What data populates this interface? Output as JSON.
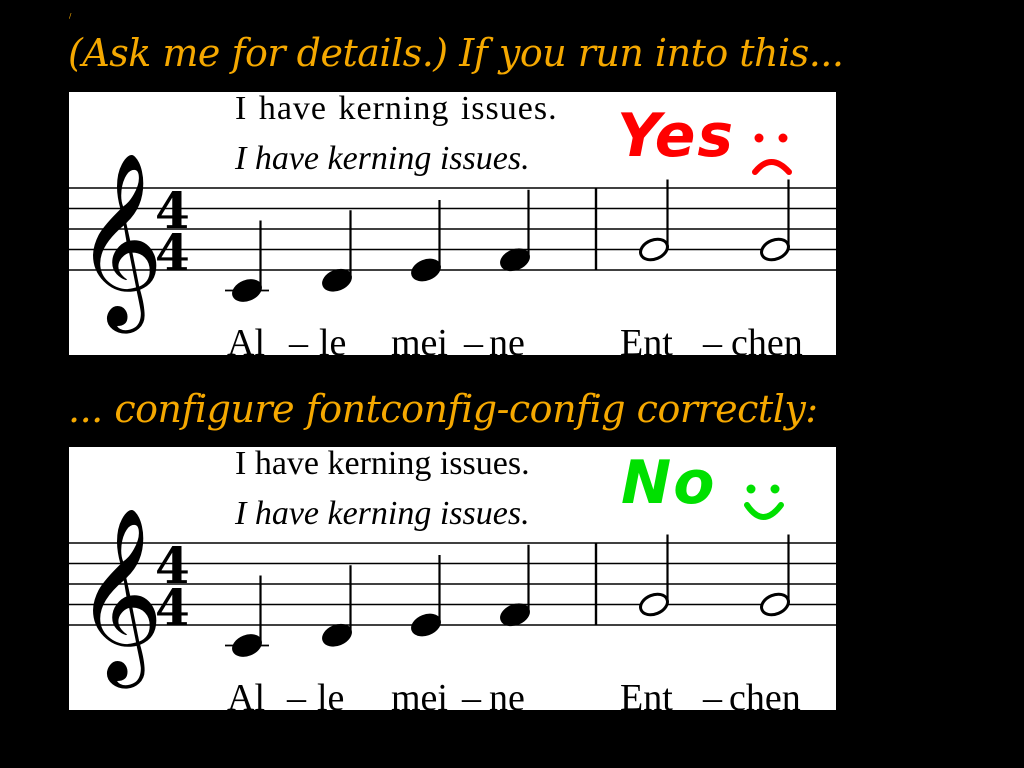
{
  "slide": {
    "corner_mark": "/",
    "heading_1": "(Ask me for details.) If you run into this...",
    "heading_2": "... configure fontconfig-config correctly:"
  },
  "sample_text": {
    "upright": "I have kerning issues.",
    "italic": "I have kerning issues."
  },
  "lyrics": {
    "al": "Al",
    "le": "le",
    "mei": "mei",
    "ne": "ne",
    "ent": "Ent",
    "chen": "chen",
    "hyphen": "–"
  },
  "annotations": {
    "yes": "Yes",
    "no": "No",
    "sad_face": "sad-face-icon",
    "happy_face": "happy-face-icon"
  },
  "colors": {
    "heading": "#f5a800",
    "yes": "#ff0000",
    "no": "#00e000",
    "background": "#000000",
    "panel": "#ffffff"
  },
  "music": {
    "clef": "treble",
    "time_signature": "4/4",
    "notes_measure_1": [
      "C",
      "D",
      "E",
      "F"
    ],
    "notes_measure_2": [
      "G",
      "G"
    ],
    "note_durations_measure_1": "quarter",
    "note_durations_measure_2": "half"
  }
}
